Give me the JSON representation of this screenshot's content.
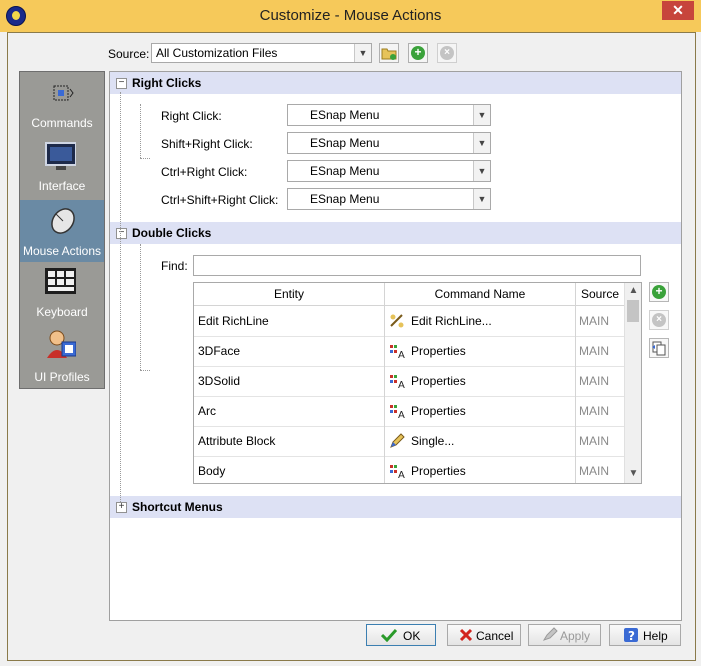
{
  "window": {
    "title": "Customize - Mouse Actions",
    "close_glyph": "✕"
  },
  "source": {
    "label": "Source:",
    "value": "All Customization Files",
    "buttons": [
      "folder-open-icon",
      "add-icon",
      "remove-icon"
    ]
  },
  "sidebar": {
    "items": [
      {
        "label": "Commands",
        "icon": "commands-icon",
        "active": false
      },
      {
        "label": "Interface",
        "icon": "monitor-icon",
        "active": false
      },
      {
        "label": "Mouse Actions",
        "icon": "mouse-icon",
        "active": true
      },
      {
        "label": "Keyboard",
        "icon": "keyboard-icon",
        "active": false
      },
      {
        "label": "UI Profiles",
        "icon": "user-profile-icon",
        "active": false
      }
    ]
  },
  "right_clicks": {
    "title": "Right Clicks",
    "expander": "⊟",
    "rows": [
      {
        "label": "Right Click:",
        "value": "ESnap Menu"
      },
      {
        "label": "Shift+Right Click:",
        "value": "ESnap Menu"
      },
      {
        "label": "Ctrl+Right Click:",
        "value": "ESnap Menu"
      },
      {
        "label": "Ctrl+Shift+Right Click:",
        "value": "ESnap Menu"
      }
    ]
  },
  "double_clicks": {
    "title": "Double Clicks",
    "expander": "⊟",
    "find_label": "Find:",
    "find_value": "",
    "columns": [
      "Entity",
      "Command Name",
      "Source"
    ],
    "rows": [
      {
        "entity": "Edit RichLine",
        "command": "Edit RichLine...",
        "source": "MAIN",
        "icon": "richline-icon"
      },
      {
        "entity": "3DFace",
        "command": "Properties",
        "source": "MAIN",
        "icon": "properties-icon"
      },
      {
        "entity": "3DSolid",
        "command": "Properties",
        "source": "MAIN",
        "icon": "properties-icon"
      },
      {
        "entity": "Arc",
        "command": "Properties",
        "source": "MAIN",
        "icon": "properties-icon"
      },
      {
        "entity": "Attribute Block",
        "command": "Single...",
        "source": "MAIN",
        "icon": "edit-pencil-icon"
      },
      {
        "entity": "Body",
        "command": "Properties",
        "source": "MAIN",
        "icon": "properties-icon"
      }
    ]
  },
  "shortcut_menus": {
    "title": "Shortcut Menus",
    "expander": "⊞"
  },
  "buttons": {
    "ok": "OK",
    "cancel": "Cancel",
    "apply": "Apply",
    "help": "Help"
  },
  "colors": {
    "title_bar": "#f6c95a",
    "active_nav": "#6a8aa4",
    "section_header": "#dde1f4",
    "close_button": "#c7453c"
  }
}
